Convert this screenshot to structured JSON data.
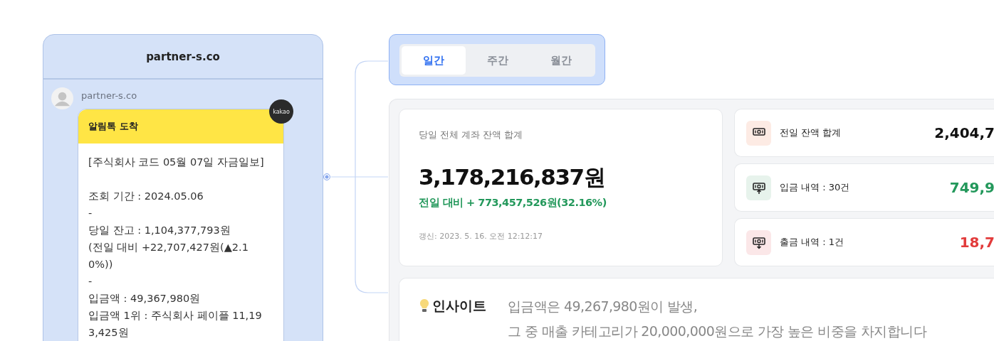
{
  "chat_preview": {
    "title": "partner-s.co",
    "sender": "partner-s.co",
    "badge": "kakao",
    "message_title": "알림톡 도착",
    "message_paragraphs": [
      [
        "[주식회사 코드 05월 07일 자금일보]"
      ],
      [
        "조회 기간 : 2024.05.06",
        "-",
        "당일 잔고 : 1,104,377,793원",
        "(전일 대비 +22,707,427원(▲2.1",
        "0%))",
        "-",
        "입금액 : 49,367,980원",
        "입금액 1위 : 주식회사 페이플 11,19",
        "3,425원"
      ]
    ]
  },
  "tabs": [
    {
      "label": "일간",
      "selected": true
    },
    {
      "label": "주간",
      "selected": false
    },
    {
      "label": "월간",
      "selected": false
    }
  ],
  "balance": {
    "label": "당일 전체 계좌 잔액 합계",
    "amount": "3,178,216,837원",
    "change": "전일 대비 + 773,457,526원(32.16%)",
    "updated": "갱신: 2023. 5. 16. 오전 12:12:17"
  },
  "stats": [
    {
      "kind": "balance",
      "label": "전일 잔액 합계",
      "value": "2,404,7"
    },
    {
      "kind": "deposit",
      "label": "입금 내역 : 30건",
      "value": "749,9"
    },
    {
      "kind": "withdrawal",
      "label": "출금 내역 : 1건",
      "value": "18,7"
    }
  ],
  "insight": {
    "title": "인사이트",
    "lines": [
      "입금액은 49,267,980원이 발생,",
      "그 중 매출 카테고리가 20,000,000원으로 가장 높은 비중을 차지합니다"
    ]
  }
}
